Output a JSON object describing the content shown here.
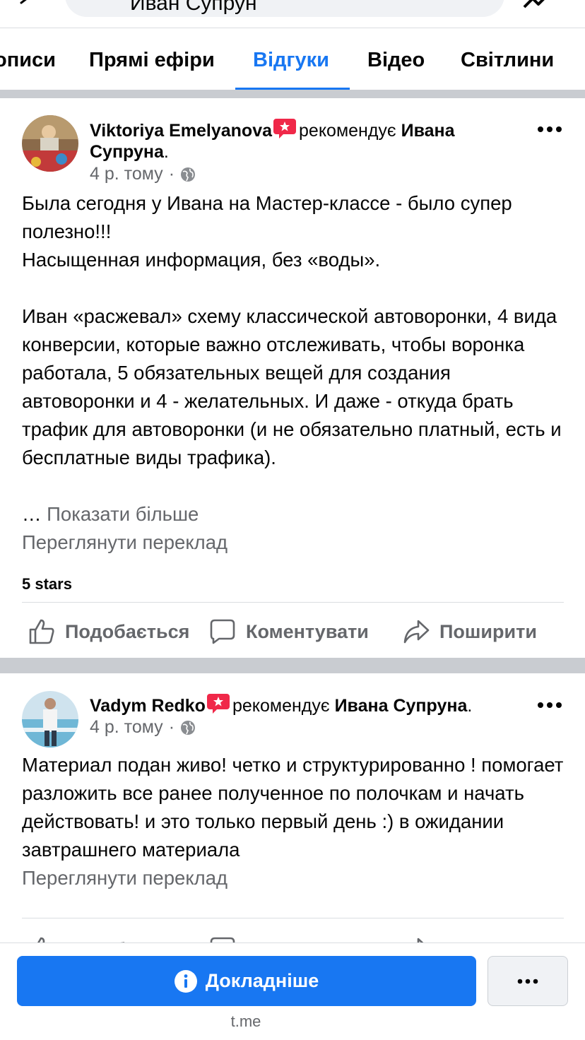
{
  "search": {
    "query": "Иван Супрун"
  },
  "tabs": [
    {
      "label": "описи"
    },
    {
      "label": "Прямі ефіри"
    },
    {
      "label": "Відгуки",
      "active": true
    },
    {
      "label": "Відео"
    },
    {
      "label": "Світлини"
    }
  ],
  "posts": [
    {
      "author": "Viktoriya  Emelyanova",
      "verb": "рекомендує",
      "target": "Ивана Супруна",
      "time": "4 р. тому",
      "separator": "·",
      "body": "Была сегодня у Ивана на Мастер-классе - было супер полезно!!!\nНасыщенная информация, без «воды».\n\nИван «расжевал» схему классической автоворонки, 4 вида конверсии, которые важно отслеживать, чтобы воронка работала, 5 обязательных вещей для создания автоворонки и 4 - желательных. И даже - откуда брать трафик для автоворонки (и не обязательно платный, есть и бесплатные виды трафика).",
      "ellipsis": "…",
      "see_more": "Показати більше",
      "translate": "Переглянути переклад",
      "stars": "5 stars"
    },
    {
      "author": "Vadym Redko",
      "verb": "рекомендує",
      "target": "Ивана Супруна",
      "time": "4 р. тому",
      "separator": "·",
      "body": "Материал подан живо! четко и структурированно ! помогает разложить все ранее полученное по полочкам и начать действовать! и это только первый день :) в ожидании завтрашнего материала",
      "translate": "Переглянути переклад"
    }
  ],
  "actions": {
    "like": "Подобається",
    "comment": "Коментувати",
    "share": "Поширити"
  },
  "bottom": {
    "button_label": "Докладніше",
    "domain": "t.me"
  },
  "colors": {
    "accent": "#1877f2",
    "secondary_text": "#65676b",
    "badge": "#f02849"
  },
  "icons": [
    "back-arrow-icon",
    "search-icon",
    "messenger-icon",
    "recommend-badge-icon",
    "globe-icon",
    "more-icon",
    "like-icon",
    "comment-icon",
    "share-icon",
    "info-icon"
  ]
}
